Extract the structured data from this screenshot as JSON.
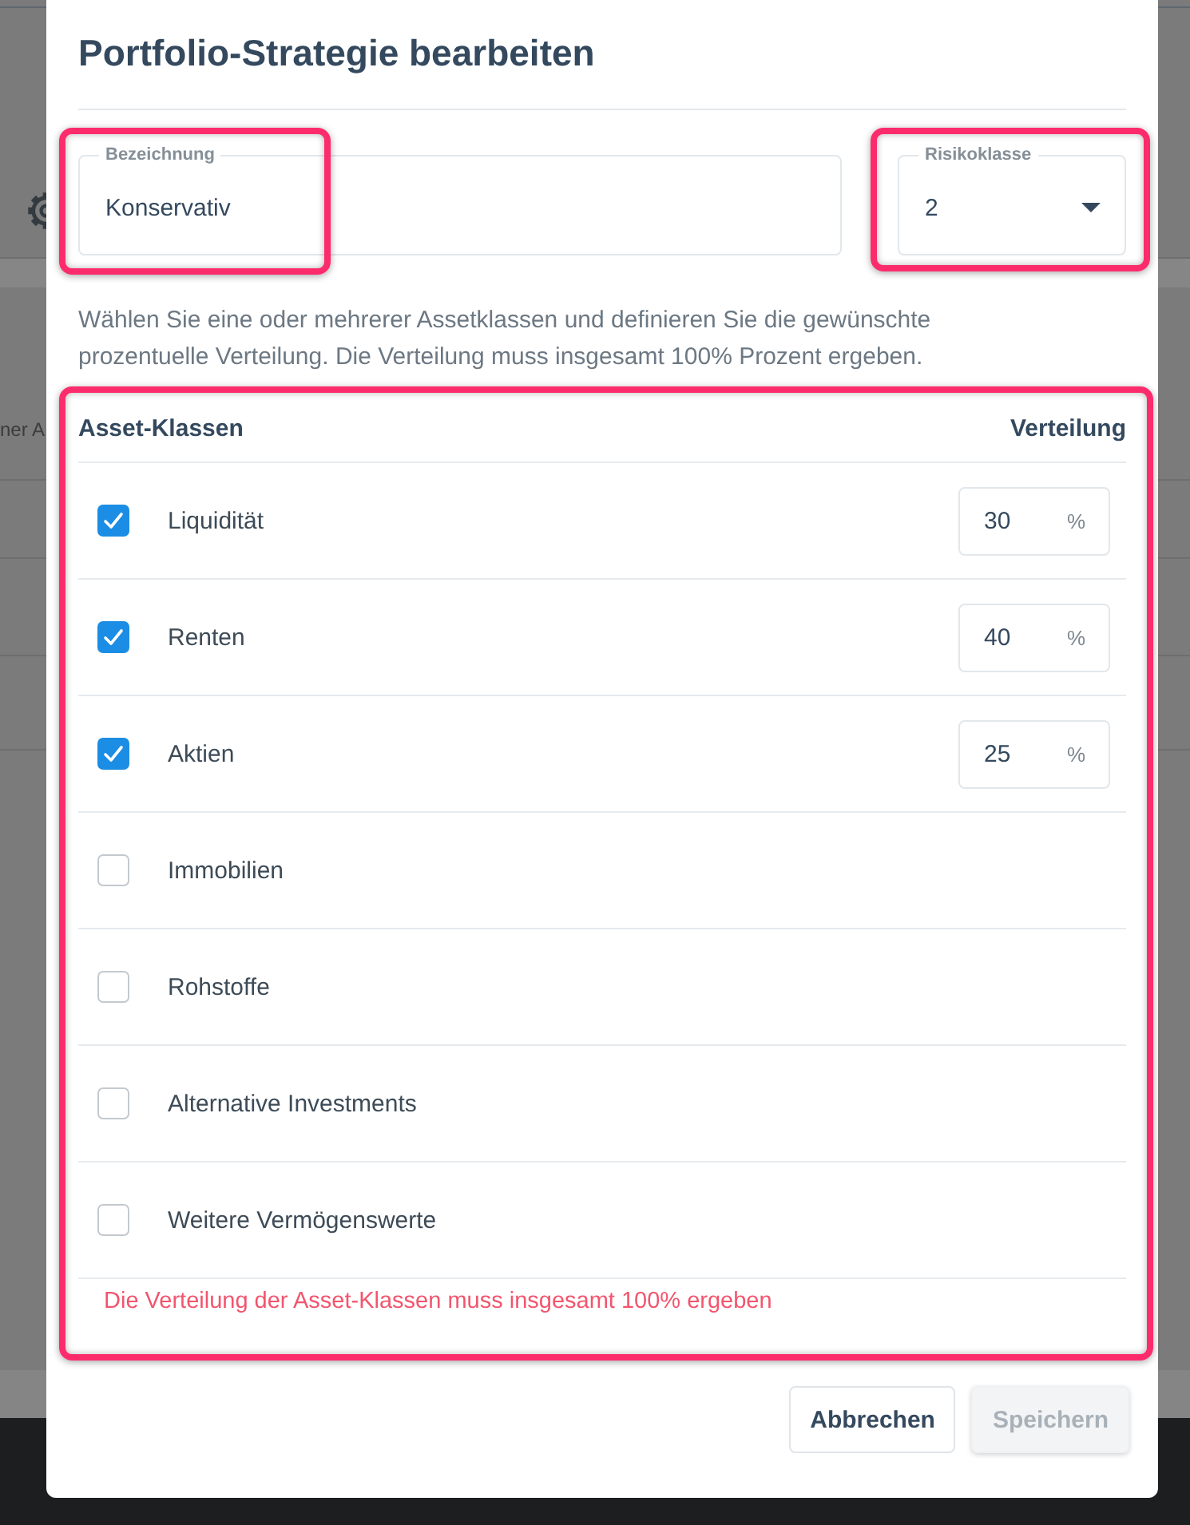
{
  "background_page": {
    "text_fragment": "ner A"
  },
  "dialog": {
    "title": "Portfolio-Strategie bearbeiten"
  },
  "name_field": {
    "label": "Bezeichnung",
    "value": "Konservativ",
    "highlighted": true
  },
  "risk_field": {
    "label": "Risikoklasse",
    "value": "2",
    "highlighted": true
  },
  "description": "Wählen Sie eine oder mehrerer Assetklassen und definieren Sie die gewünschte prozentuelle Verteilung. Die Verteilung muss insgesamt 100% Prozent ergeben.",
  "allocation_table": {
    "highlighted": true,
    "columns": [
      "Asset-Klassen",
      "Verteilung"
    ],
    "rows": [
      {
        "label": "Liquidität",
        "checked": true,
        "value": "30",
        "unit": "%"
      },
      {
        "label": "Renten",
        "checked": true,
        "value": "40",
        "unit": "%"
      },
      {
        "label": "Aktien",
        "checked": true,
        "value": "25",
        "unit": "%"
      },
      {
        "label": "Immobilien",
        "checked": false
      },
      {
        "label": "Rohstoffe",
        "checked": false
      },
      {
        "label": "Alternative Investments",
        "checked": false
      },
      {
        "label": "Weitere Vermögenswerte",
        "checked": false
      }
    ],
    "error": "Die Verteilung der Asset-Klassen muss insgesamt 100% ergeben"
  },
  "buttons": [
    {
      "label": "Abbrechen",
      "disabled": false
    },
    {
      "label": "Speichern",
      "disabled": true
    }
  ]
}
